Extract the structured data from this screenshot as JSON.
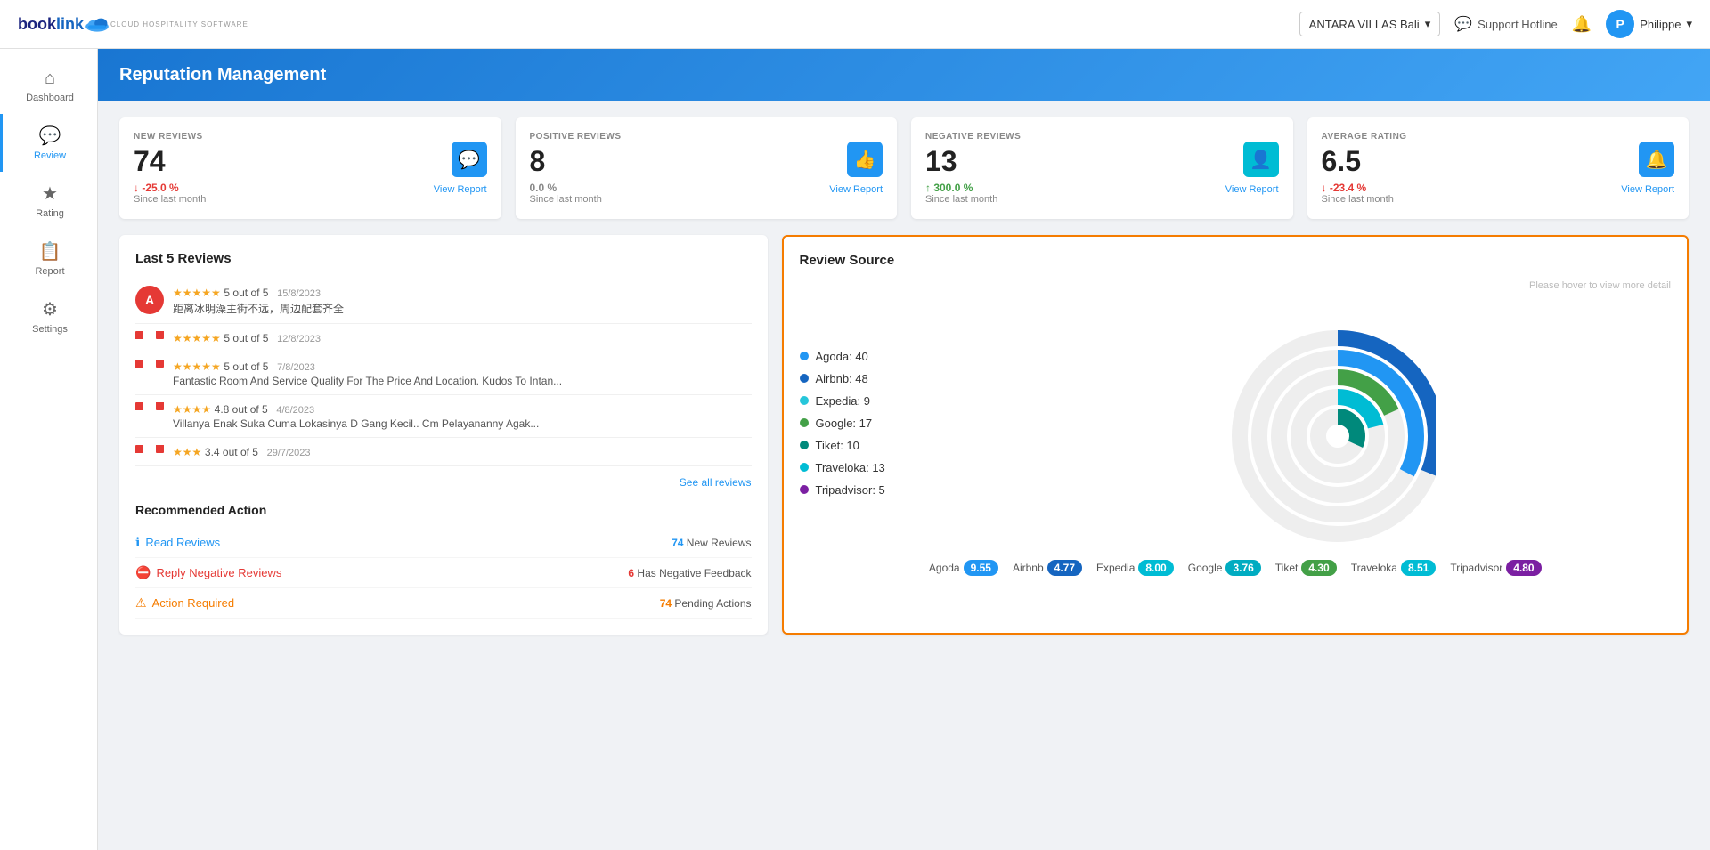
{
  "app": {
    "name": "booklink",
    "subtitle": "CLOUD HOSPITALITY SOFTWARE"
  },
  "topnav": {
    "hotel_selector": {
      "label": "ANTARA VILLAS Bali",
      "chevron": "▾"
    },
    "support_hotline": "Support Hotline",
    "user": {
      "name": "Philippe",
      "initial": "P"
    }
  },
  "sidebar": {
    "items": [
      {
        "id": "dashboard",
        "label": "Dashboard",
        "icon": "⌂",
        "active": false
      },
      {
        "id": "review",
        "label": "Review",
        "icon": "💬",
        "active": true
      },
      {
        "id": "rating",
        "label": "Rating",
        "icon": "★",
        "active": false
      },
      {
        "id": "report",
        "label": "Report",
        "icon": "📋",
        "active": false
      },
      {
        "id": "settings",
        "label": "Settings",
        "icon": "⚙",
        "active": false
      }
    ]
  },
  "page": {
    "title": "Reputation Management"
  },
  "summary_cards": [
    {
      "id": "new-reviews",
      "label": "NEW REVIEWS",
      "value": "74",
      "change": "↓ -25.0 %",
      "change_type": "negative",
      "since": "Since last month",
      "icon": "💬",
      "icon_color": "blue",
      "view_report": "View Report"
    },
    {
      "id": "positive-reviews",
      "label": "POSITIVE REVIEWS",
      "value": "8",
      "change": "0.0 %",
      "change_type": "neutral",
      "since": "Since last month",
      "icon": "👍",
      "icon_color": "blue",
      "view_report": "View Report"
    },
    {
      "id": "negative-reviews",
      "label": "NEGATIVE REVIEWS",
      "value": "13",
      "change": "↑ 300.0 %",
      "change_type": "positive",
      "since": "Since last month",
      "icon": "👤",
      "icon_color": "teal",
      "view_report": "View Report"
    },
    {
      "id": "average-rating",
      "label": "AVERAGE RATING",
      "value": "6.5",
      "change": "↓ -23.4 %",
      "change_type": "negative",
      "since": "Since last month",
      "icon": "🔔",
      "icon_color": "blue",
      "view_report": "View Report"
    }
  ],
  "last5_reviews": {
    "title": "Last 5 Reviews",
    "items": [
      {
        "score": "5 out of 5",
        "stars": 5,
        "date": "15/8/2023",
        "text": "距离冰明澡主街不远，周边配套齐全",
        "avatar_color": "#e53935",
        "source": "agoda"
      },
      {
        "score": "5 out of 5",
        "stars": 5,
        "date": "12/8/2023",
        "text": "",
        "avatar_color": "#e53935",
        "source": "tripadvisor"
      },
      {
        "score": "5 out of 5",
        "stars": 5,
        "date": "7/8/2023",
        "text": "Fantastic Room And Service Quality For The Price And Location. Kudos To Intan...",
        "avatar_color": "#e53935",
        "source": "tripadvisor"
      },
      {
        "score": "4.8 out of 5",
        "stars": 4.8,
        "date": "4/8/2023",
        "text": "Villanya Enak Suka Cuma Lokasinya D Gang Kecil.. Cm Pelayananny Agak...",
        "avatar_color": "#e53935",
        "source": "tripadvisor"
      },
      {
        "score": "3.4 out of 5",
        "stars": 3.4,
        "date": "29/7/2023",
        "text": "",
        "avatar_color": "#e53935",
        "source": "tripadvisor"
      }
    ],
    "see_all": "See all reviews"
  },
  "recommended_actions": {
    "title": "Recommended Action",
    "items": [
      {
        "id": "read-reviews",
        "label": "Read Reviews",
        "type": "blue",
        "count_prefix": "",
        "count_value": "74",
        "count_suffix": " New Reviews",
        "count_color": "blue"
      },
      {
        "id": "reply-negative",
        "label": "Reply Negative Reviews",
        "type": "red",
        "count_prefix": "",
        "count_value": "6",
        "count_suffix": " Has Negative Feedback",
        "count_color": "red"
      },
      {
        "id": "action-required",
        "label": "Action Required",
        "type": "orange",
        "count_prefix": "",
        "count_value": "74",
        "count_suffix": " Pending Actions",
        "count_color": "orange"
      }
    ]
  },
  "review_source": {
    "title": "Review Source",
    "hint": "Please hover to view more detail",
    "legend": [
      {
        "label": "Agoda: 40",
        "color": "#2196f3",
        "value": 40
      },
      {
        "label": "Airbnb: 48",
        "color": "#1565c0",
        "value": 48
      },
      {
        "label": "Expedia: 9",
        "color": "#26c6da",
        "value": 9
      },
      {
        "label": "Google: 17",
        "color": "#43a047",
        "value": 17
      },
      {
        "label": "Tiket: 10",
        "color": "#00897b",
        "value": 10
      },
      {
        "label": "Traveloka: 13",
        "color": "#00bcd4",
        "value": 13
      },
      {
        "label": "Tripadvisor: 5",
        "color": "#7b1fa2",
        "value": 5
      }
    ],
    "ratings": [
      {
        "source": "Agoda",
        "score": "9.55",
        "pill_color": "blue"
      },
      {
        "source": "Airbnb",
        "score": "4.77",
        "pill_color": "darkblue"
      },
      {
        "source": "Expedia",
        "score": "8.00",
        "pill_color": "teal"
      },
      {
        "source": "Google",
        "score": "3.76",
        "pill_color": "cyan"
      },
      {
        "source": "Tiket",
        "score": "4.30",
        "pill_color": "green"
      },
      {
        "source": "Traveloka",
        "score": "8.51",
        "pill_color": "teal"
      },
      {
        "source": "Tripadvisor",
        "score": "4.80",
        "pill_color": "purple"
      }
    ]
  }
}
